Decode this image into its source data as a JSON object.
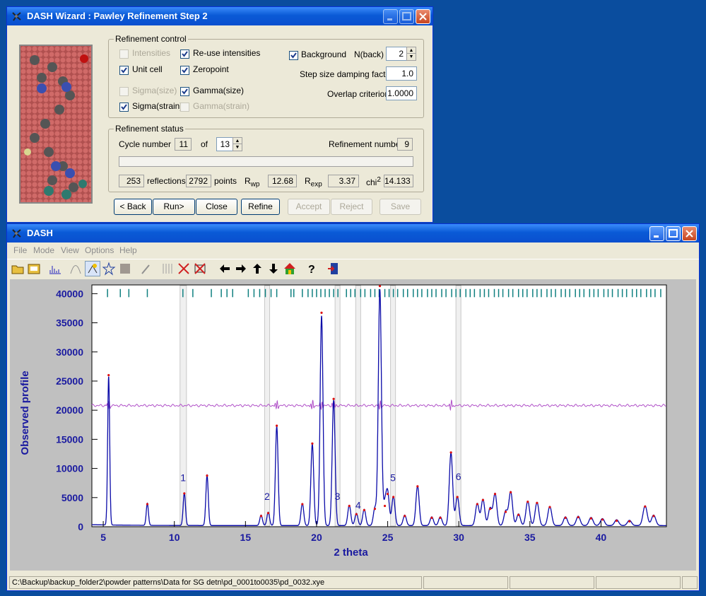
{
  "wizard": {
    "title": "DASH Wizard : Pawley Refinement Step 2",
    "refinement_control": {
      "legend": "Refinement control",
      "intensities": {
        "label": "Intensities",
        "checked": false,
        "enabled": false
      },
      "reuse_intensities": {
        "label": "Re-use intensities",
        "checked": true,
        "enabled": true
      },
      "unit_cell": {
        "label": "Unit cell",
        "checked": true,
        "enabled": true
      },
      "zeropoint": {
        "label": "Zeropoint",
        "checked": true,
        "enabled": true
      },
      "sigma_size": {
        "label": "Sigma(size)",
        "checked": false,
        "enabled": false
      },
      "gamma_size": {
        "label": "Gamma(size)",
        "checked": true,
        "enabled": true
      },
      "sigma_strain": {
        "label": "Sigma(strain)",
        "checked": true,
        "enabled": true
      },
      "gamma_strain": {
        "label": "Gamma(strain)",
        "checked": false,
        "enabled": false
      },
      "background": {
        "label": "Background",
        "checked": true
      },
      "nback_label": "N(back)",
      "nback_value": "2",
      "damping_label": "Step size damping factor",
      "damping_value": "1.0",
      "overlap_label": "Overlap criterion",
      "overlap_value": "1.0000"
    },
    "refinement_status": {
      "legend": "Refinement status",
      "cycle_label": "Cycle number",
      "cycle_value": "11",
      "of_label": "of",
      "cycle_total": "13",
      "refinement_number_label": "Refinement number",
      "refinement_number_value": "9",
      "progress": 0,
      "reflections_value": "253",
      "reflections_label": "reflections",
      "points_value": "2792",
      "points_label": "points",
      "rwp_label": "R",
      "rwp_sub": "wp",
      "rwp_value": "12.68",
      "rexp_label": "R",
      "rexp_sub": "exp",
      "rexp_value": "3.37",
      "chi2_label": "chi",
      "chi2_sup": "2",
      "chi2_value": "14.133"
    },
    "buttons": {
      "back": "< Back",
      "run": "Run>",
      "close": "Close",
      "refine": "Refine",
      "accept": "Accept",
      "reject": "Reject",
      "save": "Save"
    }
  },
  "main": {
    "title": "DASH",
    "menu": [
      "File",
      "Mode",
      "View",
      "Options",
      "Help"
    ],
    "toolbar_icons": [
      "open-folder-icon",
      "open-file-icon",
      "profile-icon",
      "peak-icon",
      "peak-fit-icon",
      "star-icon",
      "gray-box-icon",
      "wand-icon",
      "grid-icon",
      "cross-icon",
      "cross-box-icon",
      "arrow-left-icon",
      "arrow-right-icon",
      "arrow-up-icon",
      "arrow-down-icon",
      "home-icon",
      "help-icon",
      "exit-icon"
    ],
    "status_path": "C:\\Backup\\backup_folder2\\powder patterns\\Data for SG detn\\pd_0001to0035\\pd_0032.xye"
  },
  "colors": {
    "observed": "#e01010",
    "calculated": "#0a0aa8",
    "difference": "#b050c8",
    "tick": "#108080",
    "axis_text": "#1a1aa0",
    "excluded": "#c8c8c8"
  },
  "chart_data": {
    "type": "line",
    "title": "",
    "xlabel": "2  theta",
    "ylabel": "Observed  profile",
    "xlim": [
      4.2,
      44.6
    ],
    "ylim": [
      0,
      41500
    ],
    "xticks": [
      5,
      10,
      15,
      20,
      25,
      30,
      35,
      40
    ],
    "yticks": [
      0,
      5000,
      10000,
      15000,
      20000,
      25000,
      30000,
      35000,
      40000
    ],
    "background_level": 200,
    "difference_offset": 20800,
    "peaks": [
      {
        "x": 5.38,
        "y": 25500
      },
      {
        "x": 8.1,
        "y": 3800
      },
      {
        "x": 10.7,
        "y": 5600
      },
      {
        "x": 12.3,
        "y": 8600
      },
      {
        "x": 16.1,
        "y": 1800
      },
      {
        "x": 16.6,
        "y": 2300
      },
      {
        "x": 17.2,
        "y": 17000
      },
      {
        "x": 19.0,
        "y": 3800
      },
      {
        "x": 19.7,
        "y": 14000
      },
      {
        "x": 20.35,
        "y": 36000
      },
      {
        "x": 21.2,
        "y": 21500
      },
      {
        "x": 22.3,
        "y": 3500
      },
      {
        "x": 22.8,
        "y": 2100
      },
      {
        "x": 23.35,
        "y": 2800
      },
      {
        "x": 24.1,
        "y": 3000
      },
      {
        "x": 24.45,
        "y": 40500
      },
      {
        "x": 24.8,
        "y": 3500
      },
      {
        "x": 25.0,
        "y": 5500
      },
      {
        "x": 25.4,
        "y": 5000
      },
      {
        "x": 26.2,
        "y": 1800
      },
      {
        "x": 27.1,
        "y": 6800
      },
      {
        "x": 28.1,
        "y": 1500
      },
      {
        "x": 28.7,
        "y": 1500
      },
      {
        "x": 29.45,
        "y": 12500
      },
      {
        "x": 29.9,
        "y": 5000
      },
      {
        "x": 31.3,
        "y": 3800
      },
      {
        "x": 31.7,
        "y": 4500
      },
      {
        "x": 32.2,
        "y": 3000
      },
      {
        "x": 32.55,
        "y": 5500
      },
      {
        "x": 33.3,
        "y": 2500
      },
      {
        "x": 33.65,
        "y": 5800
      },
      {
        "x": 34.2,
        "y": 2000
      },
      {
        "x": 34.85,
        "y": 4200
      },
      {
        "x": 35.5,
        "y": 4000
      },
      {
        "x": 36.4,
        "y": 3300
      },
      {
        "x": 37.5,
        "y": 1500
      },
      {
        "x": 38.4,
        "y": 1600
      },
      {
        "x": 39.3,
        "y": 1400
      },
      {
        "x": 40.1,
        "y": 1200
      },
      {
        "x": 41.1,
        "y": 1000
      },
      {
        "x": 42.0,
        "y": 900
      },
      {
        "x": 43.1,
        "y": 3400
      },
      {
        "x": 43.7,
        "y": 1800
      }
    ],
    "excluded_regions": [
      {
        "label": "1",
        "x": [
          10.4,
          10.85
        ],
        "label_y": 7800
      },
      {
        "label": "2",
        "x": [
          16.35,
          16.7
        ],
        "label_y": 4600
      },
      {
        "label": "3",
        "x": [
          21.3,
          21.65
        ],
        "label_y": 4600
      },
      {
        "label": "4",
        "x": [
          22.75,
          23.1
        ],
        "label_y": 3100
      },
      {
        "label": "5",
        "x": [
          25.2,
          25.55
        ],
        "label_y": 7800
      },
      {
        "label": "6",
        "x": [
          29.8,
          30.15
        ],
        "label_y": 8000
      }
    ],
    "reflection_ticks": [
      5.3,
      6.2,
      6.8,
      8.1,
      10.6,
      11.3,
      12.6,
      13.3,
      13.7,
      14.1,
      15.2,
      15.6,
      16.0,
      16.4,
      16.8,
      17.2,
      18.2,
      18.4,
      19.0,
      19.4,
      19.7,
      20.0,
      20.3,
      20.6,
      20.9,
      21.2,
      21.5,
      22.1,
      22.4,
      22.7,
      23.1,
      23.4,
      23.8,
      24.1,
      24.4,
      24.8,
      25.1,
      25.4,
      25.7,
      26.1,
      26.4,
      26.8,
      27.1,
      27.4,
      27.8,
      28.1,
      28.4,
      28.8,
      29.1,
      29.5,
      29.8,
      30.1,
      30.5,
      30.8,
      31.1,
      31.5,
      31.8,
      32.1,
      32.5,
      32.8,
      33.1,
      33.5,
      33.8,
      34.2,
      34.5,
      34.8,
      35.2,
      35.5,
      35.8,
      36.2,
      36.5,
      36.8,
      37.2,
      37.5,
      37.8,
      38.2,
      38.5,
      38.8,
      39.2,
      39.5,
      39.8,
      40.2,
      40.5,
      40.8,
      41.2,
      41.5,
      41.8,
      42.2,
      42.5,
      42.8,
      43.2,
      43.5,
      43.8,
      44.2
    ]
  }
}
